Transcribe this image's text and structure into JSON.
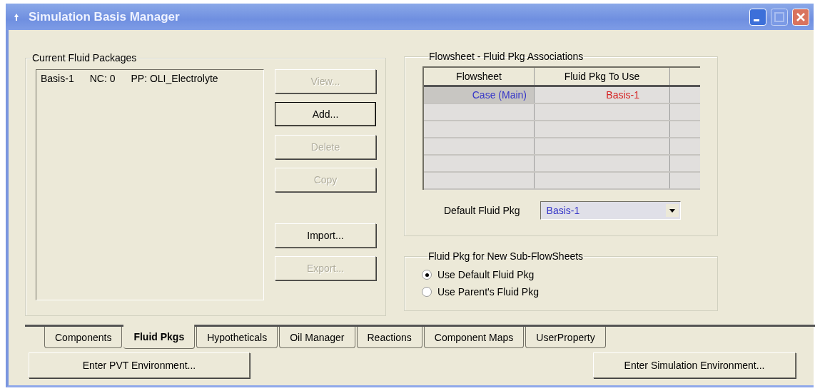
{
  "window": {
    "title": "Simulation Basis Manager"
  },
  "current_fluid_packages": {
    "title": "Current Fluid Packages",
    "items": [
      {
        "name": "Basis-1",
        "nc": "NC: 0",
        "pp": "PP: OLI_Electrolyte"
      }
    ],
    "buttons": [
      {
        "label": "View...",
        "disabled": true
      },
      {
        "label": "Add...",
        "disabled": false
      },
      {
        "label": "Delete",
        "disabled": true
      },
      {
        "label": "Copy",
        "disabled": true
      },
      {
        "label": "Import...",
        "disabled": false
      },
      {
        "label": "Export...",
        "disabled": true
      }
    ]
  },
  "associations": {
    "title": "Flowsheet - Fluid Pkg Associations",
    "table": {
      "columns": [
        "Flowsheet",
        "Fluid Pkg To Use"
      ],
      "rows": [
        [
          "Case (Main)",
          "Basis-1"
        ]
      ]
    },
    "default_label": "Default Fluid Pkg",
    "default_value": "Basis-1"
  },
  "new_subflowsheets": {
    "title": "Fluid Pkg for New Sub-FlowSheets",
    "options": [
      {
        "label": "Use Default Fluid Pkg",
        "selected": true
      },
      {
        "label": "Use Parent's Fluid Pkg",
        "selected": false
      }
    ]
  },
  "tabs": [
    {
      "label": "Components",
      "selected": false
    },
    {
      "label": "Fluid Pkgs",
      "selected": true
    },
    {
      "label": "Hypotheticals",
      "selected": false
    },
    {
      "label": "Oil Manager",
      "selected": false
    },
    {
      "label": "Reactions",
      "selected": false
    },
    {
      "label": "Component Maps",
      "selected": false
    },
    {
      "label": "UserProperty",
      "selected": false
    }
  ],
  "bottom_buttons": [
    "Enter PVT Environment...",
    "Enter Simulation Environment..."
  ]
}
